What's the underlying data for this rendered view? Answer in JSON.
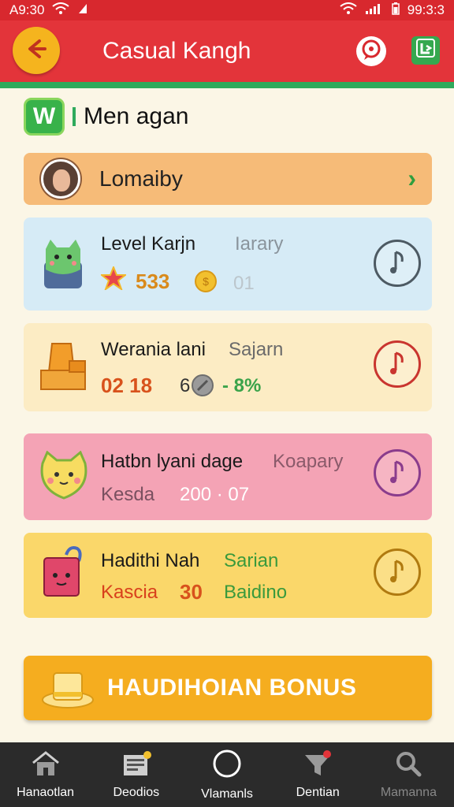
{
  "status_bar": {
    "time_left": "A9:30",
    "time_right": "99:3:3"
  },
  "app_bar": {
    "title": "Casual Kangh"
  },
  "section": {
    "logo_letter": "W",
    "title": "Men agan"
  },
  "profile": {
    "name": "Lomaiby"
  },
  "cards": [
    {
      "title": "Level Karjn",
      "subtitle": "Iarary",
      "value1": "533",
      "value2": "01",
      "circle_icon": "music-note-icon"
    },
    {
      "title": "Werania lani",
      "subtitle": "Sajarn",
      "value1": "02 18",
      "value2": "6",
      "value3": "- 8%",
      "circle_icon": "music-note-icon"
    },
    {
      "title": "Hatbn lyani dage",
      "subtitle": "Koapary",
      "value1": "Kesda",
      "value2": "200 · 07",
      "circle_icon": "music-note-icon"
    },
    {
      "title": "Hadithi Nah",
      "subtitle": "Sarian",
      "value1": "Kascia",
      "value2": "30",
      "value3": "Baidino",
      "circle_icon": "music-note-icon"
    }
  ],
  "bonus": {
    "label": "HAUDIHOIAN BONUS"
  },
  "bottom_nav": [
    {
      "label": "Hanaotlan",
      "icon": "home-icon"
    },
    {
      "label": "Deodios",
      "icon": "news-icon"
    },
    {
      "label": "Vlamanls",
      "icon": "circle-icon"
    },
    {
      "label": "Dentian",
      "icon": "funnel-icon"
    },
    {
      "label": "Mamanna",
      "icon": "search-icon"
    }
  ],
  "colors": {
    "header_red": "#e3343a",
    "accent_green": "#2faa5c",
    "back_button_yellow": "#f5b41e",
    "bonus_orange": "#f5ad1f"
  }
}
